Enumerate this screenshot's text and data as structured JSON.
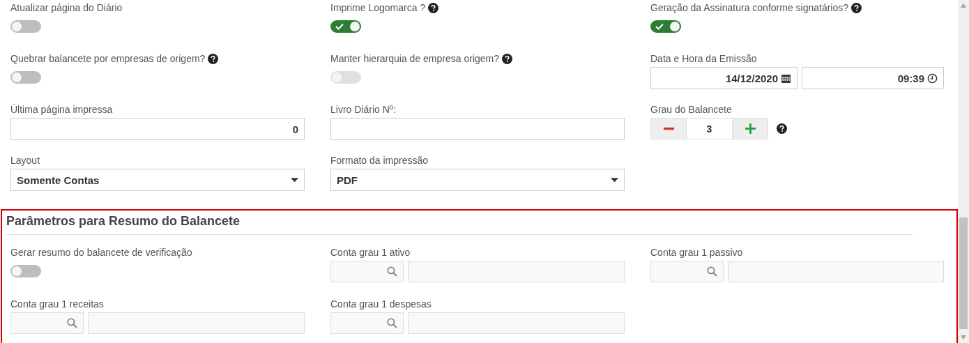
{
  "rows": [
    [
      {
        "kind": "toggle",
        "label": "Atualizar página do Diário",
        "help": false,
        "on": false,
        "disabled": false
      },
      {
        "kind": "toggle",
        "label": "Imprime Logomarca ?",
        "help": true,
        "on": true,
        "disabled": false
      },
      {
        "kind": "toggle",
        "label": "Geração da Assinatura conforme signatários?",
        "help": true,
        "on": true,
        "disabled": false
      }
    ],
    [
      {
        "kind": "toggle",
        "label": "Quebrar balancete por empresas de origem?",
        "help": true,
        "on": false,
        "disabled": false
      },
      {
        "kind": "toggle",
        "label": "Manter hierarquia de empresa origem?",
        "help": true,
        "on": false,
        "disabled": true
      },
      {
        "kind": "datetime",
        "label": "Data e Hora da Emissão",
        "date": "14/12/2020",
        "time": "09:39"
      }
    ],
    [
      {
        "kind": "number",
        "label": "Última página impressa",
        "value": "0"
      },
      {
        "kind": "text",
        "label": "Livro Diário Nº:"
      },
      {
        "kind": "stepper",
        "label": "Grau do Balancete",
        "value": "3",
        "help": true
      }
    ],
    [
      {
        "kind": "select",
        "label": "Layout",
        "value": "Somente Contas"
      },
      {
        "kind": "select",
        "label": "Formato da impressão",
        "value": "PDF"
      }
    ]
  ],
  "section": {
    "title": "Parâmetros para Resumo do Balancete",
    "rows": [
      [
        {
          "kind": "toggle",
          "label": "Gerar resumo do balancete de verificação",
          "help": false,
          "on": false,
          "disabled": false
        },
        {
          "kind": "lookup",
          "label": "Conta grau 1 ativo"
        },
        {
          "kind": "lookup",
          "label": "Conta grau 1 passivo"
        }
      ],
      [
        {
          "kind": "lookup",
          "label": "Conta grau 1 receitas"
        },
        {
          "kind": "lookup",
          "label": "Conta grau 1 despesas"
        }
      ]
    ]
  }
}
